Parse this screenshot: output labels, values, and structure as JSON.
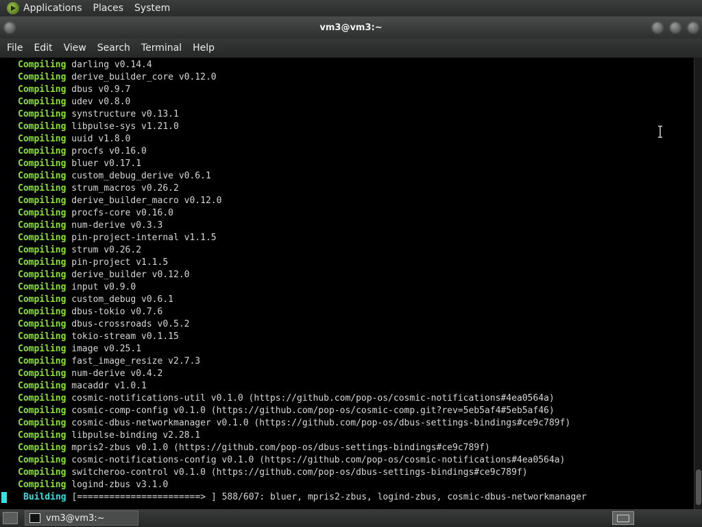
{
  "top_panel": {
    "menus": [
      "Applications",
      "Places",
      "System"
    ]
  },
  "window": {
    "title": "vm3@vm3:~"
  },
  "menubar": {
    "items": [
      "File",
      "Edit",
      "View",
      "Search",
      "Terminal",
      "Help"
    ]
  },
  "terminal": {
    "colors": {
      "keyword": "#8ae234",
      "building": "#34e2e2",
      "text": "#d7d7d7",
      "background": "#000000"
    },
    "lines": [
      {
        "kw": "Compiling",
        "text": "darling v0.14.4"
      },
      {
        "kw": "Compiling",
        "text": "derive_builder_core v0.12.0"
      },
      {
        "kw": "Compiling",
        "text": "dbus v0.9.7"
      },
      {
        "kw": "Compiling",
        "text": "udev v0.8.0"
      },
      {
        "kw": "Compiling",
        "text": "synstructure v0.13.1"
      },
      {
        "kw": "Compiling",
        "text": "libpulse-sys v1.21.0"
      },
      {
        "kw": "Compiling",
        "text": "uuid v1.8.0"
      },
      {
        "kw": "Compiling",
        "text": "procfs v0.16.0"
      },
      {
        "kw": "Compiling",
        "text": "bluer v0.17.1"
      },
      {
        "kw": "Compiling",
        "text": "custom_debug_derive v0.6.1"
      },
      {
        "kw": "Compiling",
        "text": "strum_macros v0.26.2"
      },
      {
        "kw": "Compiling",
        "text": "derive_builder_macro v0.12.0"
      },
      {
        "kw": "Compiling",
        "text": "procfs-core v0.16.0"
      },
      {
        "kw": "Compiling",
        "text": "num-derive v0.3.3"
      },
      {
        "kw": "Compiling",
        "text": "pin-project-internal v1.1.5"
      },
      {
        "kw": "Compiling",
        "text": "strum v0.26.2"
      },
      {
        "kw": "Compiling",
        "text": "pin-project v1.1.5"
      },
      {
        "kw": "Compiling",
        "text": "derive_builder v0.12.0"
      },
      {
        "kw": "Compiling",
        "text": "input v0.9.0"
      },
      {
        "kw": "Compiling",
        "text": "custom_debug v0.6.1"
      },
      {
        "kw": "Compiling",
        "text": "dbus-tokio v0.7.6"
      },
      {
        "kw": "Compiling",
        "text": "dbus-crossroads v0.5.2"
      },
      {
        "kw": "Compiling",
        "text": "tokio-stream v0.1.15"
      },
      {
        "kw": "Compiling",
        "text": "image v0.25.1"
      },
      {
        "kw": "Compiling",
        "text": "fast_image_resize v2.7.3"
      },
      {
        "kw": "Compiling",
        "text": "num-derive v0.4.2"
      },
      {
        "kw": "Compiling",
        "text": "macaddr v1.0.1"
      },
      {
        "kw": "Compiling",
        "text": "cosmic-notifications-util v0.1.0 (https://github.com/pop-os/cosmic-notifications#4ea0564a)"
      },
      {
        "kw": "Compiling",
        "text": "cosmic-comp-config v0.1.0 (https://github.com/pop-os/cosmic-comp.git?rev=5eb5af4#5eb5af46)"
      },
      {
        "kw": "Compiling",
        "text": "cosmic-dbus-networkmanager v0.1.0 (https://github.com/pop-os/dbus-settings-bindings#ce9c789f)"
      },
      {
        "kw": "Compiling",
        "text": "libpulse-binding v2.28.1"
      },
      {
        "kw": "Compiling",
        "text": "mpris2-zbus v0.1.0 (https://github.com/pop-os/dbus-settings-bindings#ce9c789f)"
      },
      {
        "kw": "Compiling",
        "text": "cosmic-notifications-config v0.1.0 (https://github.com/pop-os/cosmic-notifications#4ea0564a)"
      },
      {
        "kw": "Compiling",
        "text": "switcheroo-control v0.1.0 (https://github.com/pop-os/dbus-settings-bindings#ce9c789f)"
      },
      {
        "kw": "Compiling",
        "text": "logind-zbus v3.1.0"
      }
    ],
    "building": {
      "kw": "Building",
      "text": "[=======================> ] 588/607: bluer, mpris2-zbus, logind-zbus, cosmic-dbus-networkmanager"
    }
  },
  "taskbar": {
    "task_label": "vm3@vm3:~"
  }
}
